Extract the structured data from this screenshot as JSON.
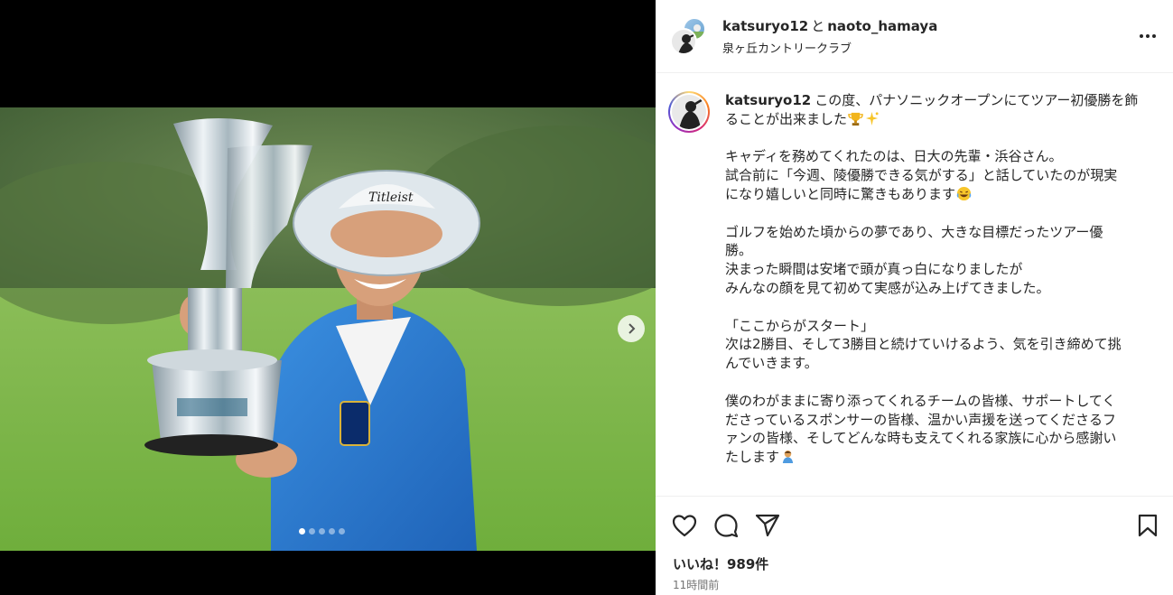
{
  "media": {
    "image_alt": "Golfer in a blue jacket and white hat holding a silver trophy",
    "carousel": {
      "total": 5,
      "active_index": 0
    }
  },
  "header": {
    "user1": "katsuryo12",
    "conjunction": "と",
    "user2": "naoto_hamaya",
    "location": "泉ヶ丘カントリークラブ"
  },
  "caption": {
    "username": "katsuryo12",
    "paragraphs": [
      [
        "この度、パナソニックオープンにてツアー初優勝を飾",
        "ることが出来ました"
      ],
      [
        "キャディを務めてくれたのは、日大の先輩・浜谷さん。",
        "試合前に「今週、陵優勝できる気がする」と話していたのが現実",
        "になり嬉しいと同時に驚きもあります"
      ],
      [
        "ゴルフを始めた頃からの夢であり、大きな目標だったツアー優",
        "勝。",
        "決まった瞬間は安堵で頭が真っ白になりましたが",
        "みんなの顔を見て初めて実感が込み上げてきました。"
      ],
      [
        "「ここからがスタート」",
        "次は2勝目、そして3勝目と続けていけるよう、気を引き締めて挑",
        "んでいきます。"
      ],
      [
        "僕のわがままに寄り添ってくれるチームの皆様、サポートしてく",
        "ださっているスポンサーの皆様、温かい声援を送ってくださるフ",
        "ァンの皆様、そしてどんな時も支えてくれる家族に心から感謝い",
        "たします"
      ]
    ]
  },
  "actions": {
    "like_icon": "heart-icon",
    "comment_icon": "comment-icon",
    "share_icon": "share-icon",
    "save_icon": "bookmark-icon"
  },
  "likes_text": "いいね！989件",
  "timestamp": "11時間前"
}
